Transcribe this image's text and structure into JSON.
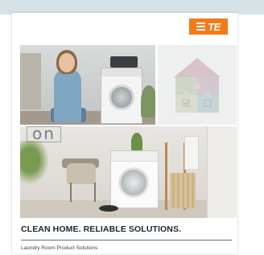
{
  "brand": {
    "logo_text": "TE",
    "logo_color": "#f27b1a"
  },
  "cover": {
    "background_text": "on",
    "headline": "CLEAN HOME. RELIABLE SOLUTIONS.",
    "subtitle": "Laundry Room Product Solutions"
  },
  "colors": {
    "top_band": "#d7e1e8",
    "headline": "#1a2530"
  }
}
